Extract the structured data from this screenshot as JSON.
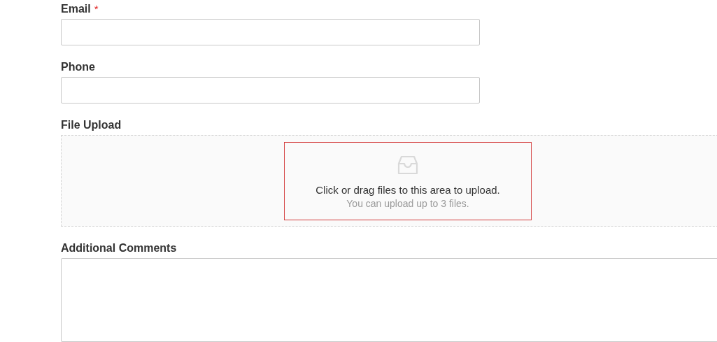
{
  "fields": [
    {
      "kind": "input",
      "label": "Email",
      "required_mark": "*"
    },
    {
      "kind": "input",
      "label": "Phone"
    },
    {
      "kind": "upload",
      "label": "File Upload",
      "highlighted": true,
      "hint": "Click or drag files to this area to upload.",
      "subhint": "You can upload up to 3 files."
    },
    {
      "kind": "textarea",
      "label": "Additional Comments"
    }
  ]
}
